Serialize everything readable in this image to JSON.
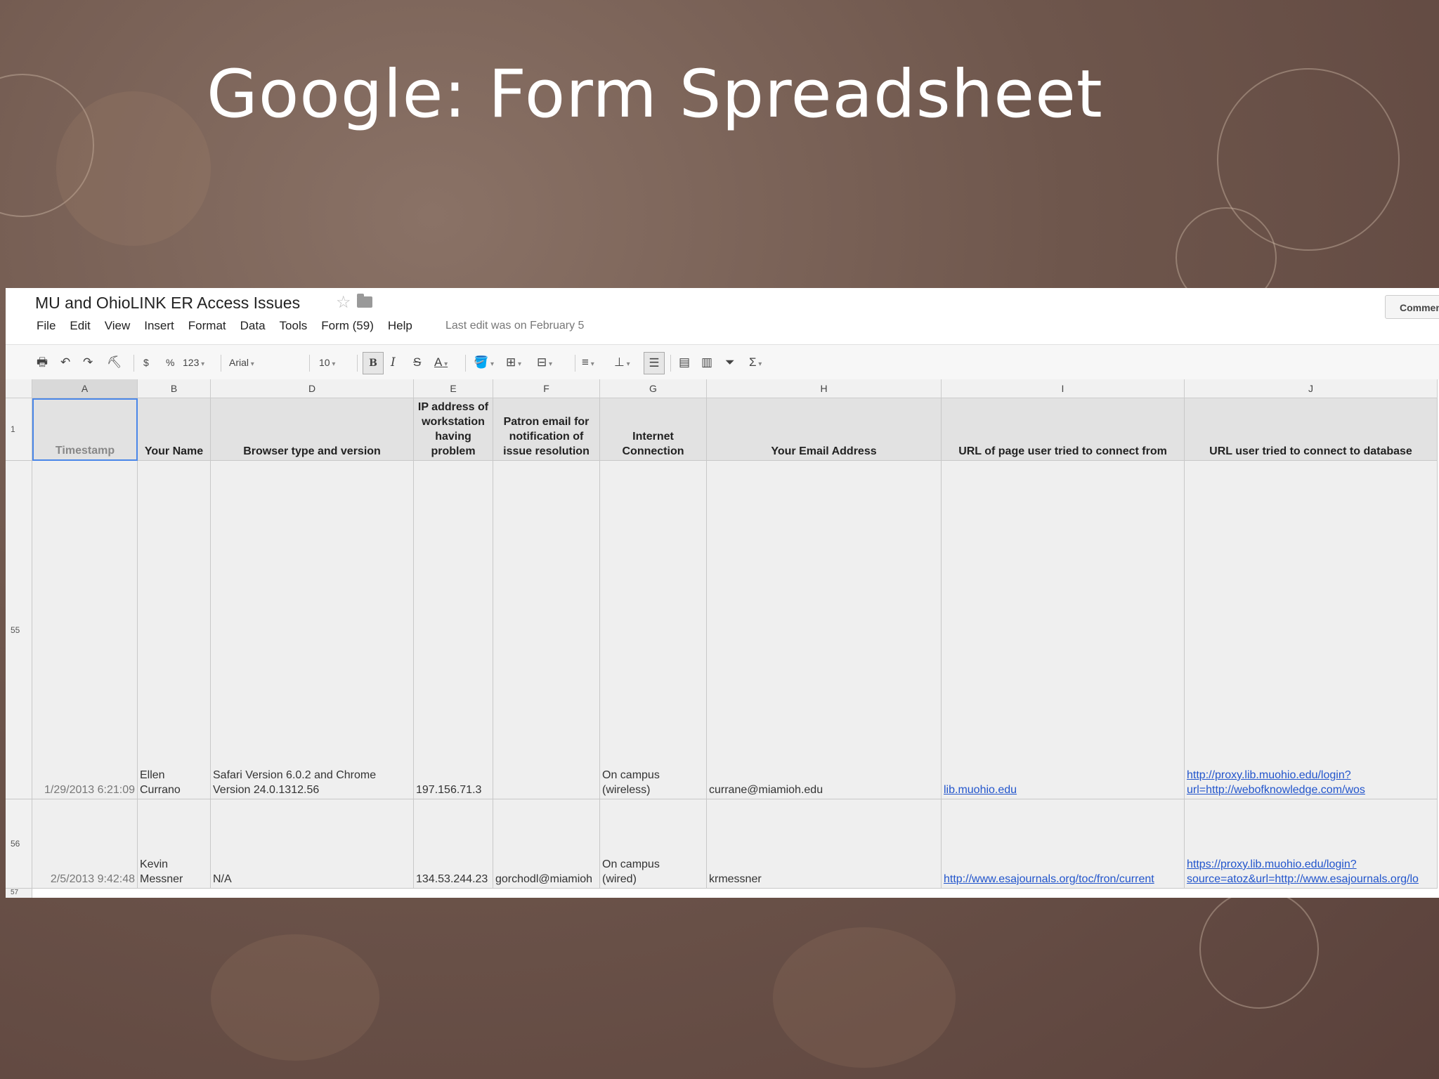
{
  "slide": {
    "title": "Google: Form Spreadsheet"
  },
  "app": {
    "doc_title": "MU and OhioLINK ER Access Issues",
    "comment_button": "Comment",
    "menu": [
      "File",
      "Edit",
      "View",
      "Insert",
      "Format",
      "Data",
      "Tools",
      "Form (59)",
      "Help"
    ],
    "last_edit": "Last edit was on February 5"
  },
  "toolbar": {
    "currency": "$",
    "percent": "%",
    "number_format": "123",
    "font": "Arial",
    "font_size": "10",
    "bold": "B",
    "italic": "I",
    "strike": "S",
    "text_color": "A",
    "sum": "Σ"
  },
  "columns": [
    "A",
    "B",
    "D",
    "E",
    "F",
    "G",
    "H",
    "I",
    "J"
  ],
  "row_headers": [
    "1",
    "55",
    "56",
    "57"
  ],
  "header_cells": [
    "Timestamp",
    "Your Name",
    "Browser type and version",
    "IP address of workstation having problem",
    "Patron email for notification of issue resolution",
    "Internet Connection",
    "Your Email Address",
    "URL of page user tried to connect from",
    "URL user tried to connect to database"
  ],
  "rows": [
    {
      "timestamp": "1/29/2013 6:21:09",
      "name": [
        "Ellen",
        "Currano"
      ],
      "browser": [
        "Safari Version 6.0.2 and Chrome",
        "Version 24.0.1312.56"
      ],
      "ip": "197.156.71.3",
      "patron_email": "",
      "connection": [
        "On campus",
        "(wireless)"
      ],
      "email": "currane@miamioh.edu",
      "from_url": "lib.muohio.edu",
      "db_url": [
        "http://proxy.lib.muohio.edu/login?",
        "url=http://webofknowledge.com/wos"
      ]
    },
    {
      "timestamp": "2/5/2013 9:42:48",
      "name": [
        "Kevin",
        "Messner"
      ],
      "browser": [
        "N/A",
        ""
      ],
      "ip": "134.53.244.23",
      "patron_email": "gorchodl@miamioh",
      "connection": [
        "On campus",
        "(wired)"
      ],
      "email": "krmessner",
      "from_url": "http://www.esajournals.org/toc/fron/current",
      "db_url": [
        "https://proxy.lib.muohio.edu/login?",
        "source=atoz&url=http://www.esajournals.org/lo"
      ]
    }
  ]
}
